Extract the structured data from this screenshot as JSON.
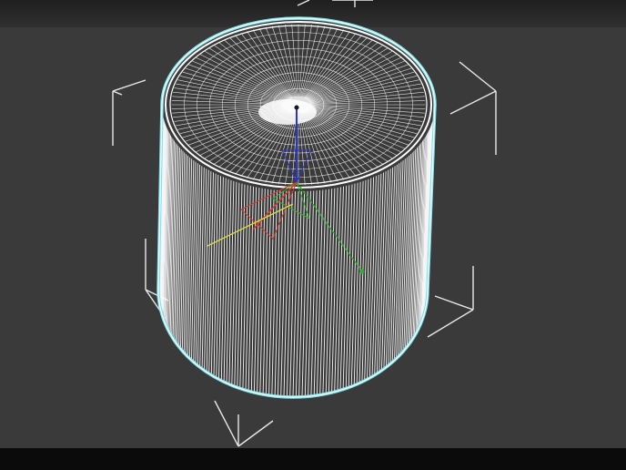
{
  "viewport": {
    "label": "",
    "background": "#3a3a3a",
    "selection_color": "#7fe3ee",
    "wire_color": "#ffffff",
    "bbox_color": "#e8e8e8"
  },
  "object": {
    "shape": "cylinder",
    "display_mode": "wireframe",
    "selected": true
  },
  "gizmo": {
    "type": "transform-gizmo",
    "axes": [
      {
        "axis": "x",
        "color": "#d43a2a"
      },
      {
        "axis": "y",
        "color": "#2fae2f"
      },
      {
        "axis": "z",
        "color": "#2a35c8"
      }
    ]
  }
}
